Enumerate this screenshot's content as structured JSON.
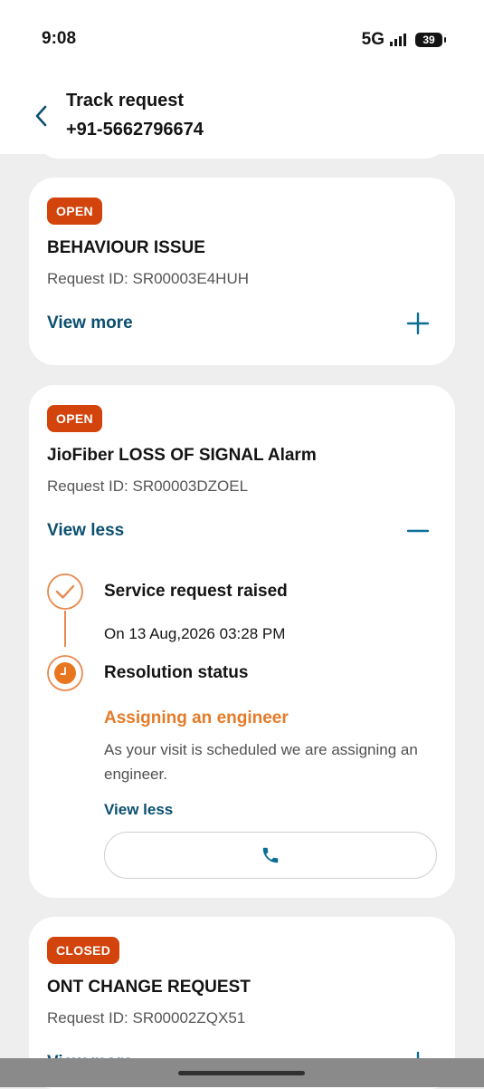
{
  "status_bar": {
    "time": "9:08",
    "network": "5G",
    "battery": "39"
  },
  "header": {
    "title": "Track request",
    "phone": "+91-5662796674"
  },
  "colors": {
    "accent": "#0b4f70",
    "badge": "#d2440c",
    "timeline": "#e8894f",
    "status_orange": "#e57b28"
  },
  "cards": [
    {
      "badge": "OPEN",
      "title": "BEHAVIOUR ISSUE",
      "request_id": "Request ID: SR00003E4HUH",
      "toggle_label": "View more",
      "toggle_icon": "plus-icon"
    },
    {
      "badge": "OPEN",
      "title": "JioFiber LOSS OF SIGNAL Alarm",
      "request_id": "Request ID: SR00003DZOEL",
      "toggle_label": "View less",
      "toggle_icon": "minus-icon",
      "timeline": {
        "step1_heading": "Service request raised",
        "step1_date": "On 13 Aug,2026 03:28 PM",
        "step2_heading": "Resolution status",
        "status_title": "Assigning an engineer",
        "status_desc": "As your visit is scheduled we are assigning an engineer.",
        "view_less": "View less",
        "call_icon": "phone-icon"
      }
    },
    {
      "badge": "CLOSED",
      "title": "ONT CHANGE REQUEST",
      "request_id": "Request ID: SR00002ZQX51",
      "toggle_label": "View more",
      "toggle_icon": "plus-icon"
    }
  ]
}
